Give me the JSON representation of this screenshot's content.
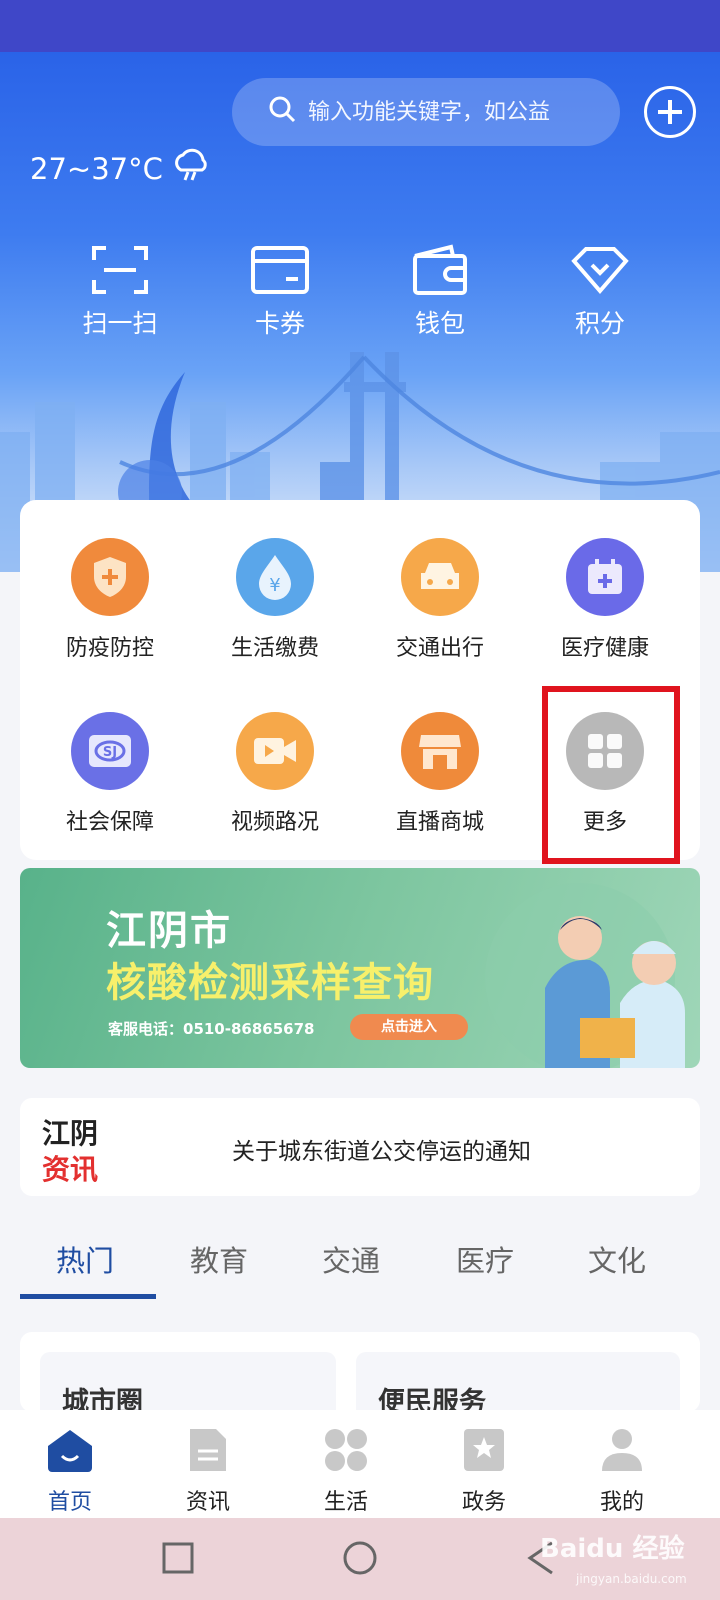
{
  "header": {
    "weather_text": "27~37°C",
    "search_placeholder": "输入功能关键字，如公益"
  },
  "quick_actions": [
    {
      "label": "扫一扫",
      "icon": "scan-icon"
    },
    {
      "label": "卡券",
      "icon": "card-icon"
    },
    {
      "label": "钱包",
      "icon": "wallet-icon"
    },
    {
      "label": "积分",
      "icon": "diamond-icon"
    }
  ],
  "services": [
    {
      "label": "防疫防控",
      "icon": "shield-icon",
      "color": "#f08a3c"
    },
    {
      "label": "生活缴费",
      "icon": "water-drop-icon",
      "color": "#5aa6ea"
    },
    {
      "label": "交通出行",
      "icon": "car-icon",
      "color": "#f6a84a"
    },
    {
      "label": "医疗健康",
      "icon": "calendar-plus-icon",
      "color": "#6a6ae8"
    },
    {
      "label": "社会保障",
      "icon": "social-security-icon",
      "color": "#6a70e6"
    },
    {
      "label": "视频路况",
      "icon": "video-icon",
      "color": "#f6a84a"
    },
    {
      "label": "直播商城",
      "icon": "shop-icon",
      "color": "#ef8a3a"
    },
    {
      "label": "更多",
      "icon": "grid-icon",
      "color": "#b8b8b8"
    }
  ],
  "banner": {
    "line1": "江阴市",
    "line2": "核酸检测采样查询",
    "phone": "客服电话：0510-86865678",
    "cta": "点击进入"
  },
  "notice": {
    "logo_top": "江阴",
    "logo_bottom": "资讯",
    "text": "关于城东街道公交停运的通知"
  },
  "tabs": [
    "热门",
    "教育",
    "交通",
    "医疗",
    "文化"
  ],
  "content_cards": [
    "城市圈",
    "便民服务"
  ],
  "tabbar": [
    {
      "label": "首页",
      "icon": "home-icon",
      "active": true
    },
    {
      "label": "资讯",
      "icon": "document-icon",
      "active": false
    },
    {
      "label": "生活",
      "icon": "clover-icon",
      "active": false
    },
    {
      "label": "政务",
      "icon": "star-badge-icon",
      "active": false
    },
    {
      "label": "我的",
      "icon": "user-icon",
      "active": false
    }
  ],
  "watermark": {
    "main": "Baidu 经验",
    "sub": "jingyan.baidu.com"
  },
  "colors": {
    "accent": "#1f4da2",
    "highlight_border": "#e0141e",
    "hero_top": "#2a63e8"
  }
}
